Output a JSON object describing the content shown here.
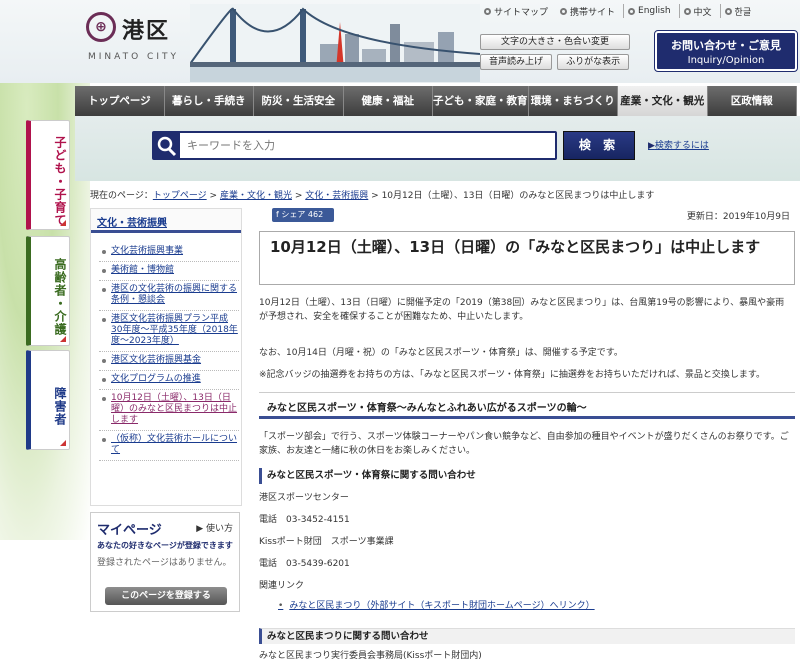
{
  "header": {
    "logo_title": "港区",
    "logo_sub": "MINATO CITY",
    "top_links": [
      "サイトマップ",
      "携帯サイト",
      "English",
      "中文",
      "한글"
    ],
    "acc_buttons": [
      "文字の大きさ・色合い変更",
      "音声読み上げ",
      "ふりがな表示"
    ],
    "inquiry_line1": "お問い合わせ・ご意見",
    "inquiry_line2": "Inquiry/Opinion"
  },
  "nav": [
    "トップページ",
    "暮らし・手続き",
    "防災・生活安全",
    "健康・福祉",
    "子ども・家庭・教育",
    "環境・まちづくり",
    "産業・文化・観光",
    "区政情報"
  ],
  "search": {
    "placeholder": "キーワードを入力",
    "button": "検 索",
    "help": "検索するには"
  },
  "side_tabs": [
    "子ども・子育て",
    "高齢者・介護",
    "障害者"
  ],
  "breadcrumb": {
    "prefix": "現在のページ：",
    "items": [
      "トップページ",
      "産業・文化・観光",
      "文化・芸術振興"
    ],
    "current": "10月12日（土曜）、13日（日曜）のみなと区民まつりは中止します",
    "sep": ">"
  },
  "local_nav": {
    "heading": "文化・芸術振興",
    "items": [
      "文化芸術振興事業",
      "美術館・博物館",
      "港区の文化芸術の振興に関する条例・懇談会",
      "港区文化芸術振興プラン平成30年度～平成35年度（2018年度～2023年度）",
      "港区文化芸術振興基金",
      "文化プログラムの推進",
      "10月12日（土曜）、13日（日曜）のみなと区民まつりは中止します",
      "（仮称）文化芸術ホールについて"
    ]
  },
  "mypage": {
    "title": "マイページ",
    "howto": "使い方",
    "sub": "あなたの好きなページが登録できます",
    "empty": "登録されたページはありません。",
    "register": "このページを登録する"
  },
  "article": {
    "share": "シェア 462",
    "updated": "更新日：2019年10月9日",
    "title": "10月12日（土曜）、13日（日曜）の「みなと区民まつり」は中止します",
    "p1": "10月12日（土曜）、13日（日曜）に開催予定の「2019（第38回）みなと区民まつり」は、台風第19号の影響により、暴風や豪雨が予想され、安全を確保することが困難なため、中止いたします。",
    "p2": "なお、10月14日（月曜・祝）の「みなと区民スポーツ・体育祭」は、開催する予定です。",
    "p3": "※記念バッジの抽選券をお持ちの方は、「みなと区民スポーツ・体育祭」に抽選券をお持ちいただければ、景品と交換します。",
    "h2": "みなと区民スポーツ・体育祭～みんなとふれあい広がるスポーツの輪～",
    "p4": "「スポーツ部会」で行う、スポーツ体験コーナーやパン食い競争など、自由参加の種目やイベントが盛りだくさんのお祭りです。ご家族、お友達と一緒に秋の休日をお楽しみください。",
    "h3a": "みなと区民スポーツ・体育祭に関する問い合わせ",
    "contact1_name": "港区スポーツセンター",
    "contact1_tel": "電話　03-3452-4151",
    "contact2_name": "Kissポート財団　スポーツ事業課",
    "contact2_tel": "電話　03-5439-6201",
    "related": "関連リンク",
    "ext_link": "みなと区民まつり（外部サイト（キスポート財団ホームページ）へリンク）",
    "h3b": "みなと区民まつりに関する問い合わせ",
    "contact3": "みなと区民まつり実行委員会事務局(Kissポート財団内)"
  }
}
